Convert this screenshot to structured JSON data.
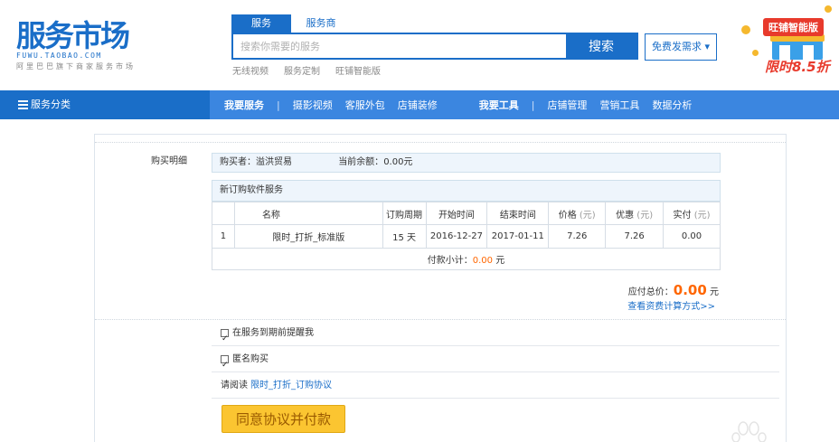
{
  "logo": {
    "main": "服务市场",
    "domain": "FUWU.TAOBAO.COM",
    "slogan": "阿里巴巴旗下商家服务市场"
  },
  "search": {
    "tabs": [
      {
        "label": "服务",
        "active": true
      },
      {
        "label": "服务商",
        "active": false
      }
    ],
    "placeholder": "搜索你需要的服务",
    "button": "搜索",
    "hot_links": [
      "无线视频",
      "服务定制",
      "旺铺智能版"
    ]
  },
  "demand_button": "免费发需求 ▾",
  "promo": {
    "title": "旺铺智能版",
    "discount": "限时8.5折"
  },
  "nav": {
    "category": "服务分类",
    "group1_title": "我要服务",
    "group1_items": [
      "摄影视频",
      "客服外包",
      "店铺装修"
    ],
    "group2_title": "我要工具",
    "group2_items": [
      "店铺管理",
      "营销工具",
      "数据分析"
    ],
    "separator": "|"
  },
  "purchase": {
    "section_label": "购买明细",
    "buyer_label": "购买者：",
    "buyer_name": "溢洪贸易",
    "balance_label": "当前余额：",
    "balance_value": "0.00元",
    "order_title": "新订购软件服务",
    "columns": [
      "",
      "名称",
      "订购周期",
      "开始时间",
      "结束时间",
      "价格",
      "优惠",
      "实付"
    ],
    "unit": "(元)",
    "rows": [
      {
        "index": "1",
        "name": "限时_打折_标准版",
        "period": "15 天",
        "start": "2016-12-27",
        "end": "2017-01-11",
        "price": "7.26",
        "discount": "7.26",
        "paid": "0.00"
      }
    ],
    "subtotal_label": "付款小计：",
    "subtotal_value": "0.00",
    "subtotal_unit": "元",
    "total_label": "应付总价：",
    "total_value": "0.00",
    "total_unit": "元",
    "fee_link": "查看资费计算方式>>"
  },
  "options": {
    "remind": "在服务到期前提醒我",
    "anonymous": "匿名购买",
    "agreement_prefix": "请阅读",
    "agreement_link": "限时_打折_订购协议",
    "agree_button": "同意协议并付款"
  },
  "colors": {
    "brand": "#1a6ec8",
    "nav": "#3b86e0",
    "accent": "#ff6600",
    "button": "#fbc531"
  }
}
